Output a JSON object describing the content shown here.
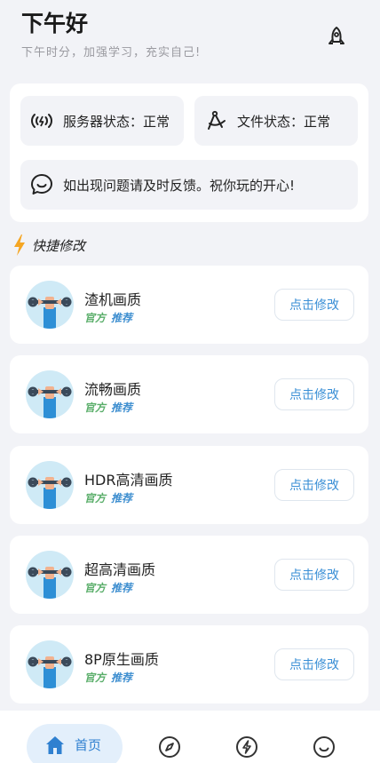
{
  "header": {
    "greeting": "下午好",
    "subtitle": "下午时分，加强学习，充实自己!"
  },
  "status": {
    "server_label": "服务器状态：正常",
    "file_label": "文件状态：正常",
    "feedback_text": "如出现问题请及时反馈。祝你玩的开心!"
  },
  "section": {
    "title": "快捷修改"
  },
  "items": [
    {
      "name": "渣机画质",
      "tag_official": "官方",
      "tag_rec": "推荐",
      "button": "点击修改"
    },
    {
      "name": "流畅画质",
      "tag_official": "官方",
      "tag_rec": "推荐",
      "button": "点击修改"
    },
    {
      "name": "HDR高清画质",
      "tag_official": "官方",
      "tag_rec": "推荐",
      "button": "点击修改"
    },
    {
      "name": "超高清画质",
      "tag_official": "官方",
      "tag_rec": "推荐",
      "button": "点击修改"
    },
    {
      "name": "8P原生画质",
      "tag_official": "官方",
      "tag_rec": "推荐",
      "button": "点击修改"
    }
  ],
  "nav": {
    "home_label": "首页",
    "icons": [
      "home-icon",
      "compass-icon",
      "lightning-icon",
      "smile-icon"
    ]
  },
  "colors": {
    "accent": "#3a8fd6",
    "official_green": "#5aae6a",
    "bolt_orange": "#f5a623",
    "background": "#f2f3f7"
  }
}
